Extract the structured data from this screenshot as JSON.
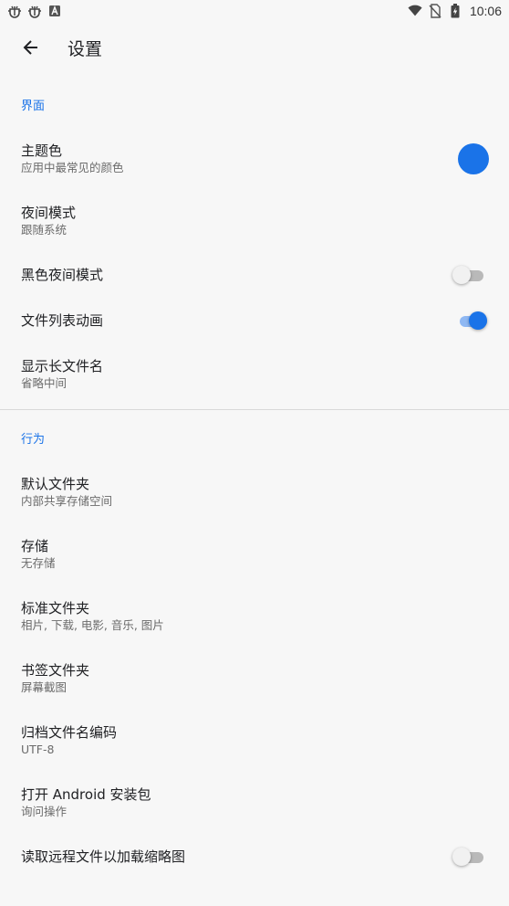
{
  "status_bar": {
    "time": "10:06",
    "left_icons": [
      "bug-icon",
      "bug-icon",
      "font-icon"
    ],
    "right_icons": [
      "wifi-icon",
      "no-sim-icon",
      "battery-charging-icon"
    ]
  },
  "app_bar": {
    "title": "设置",
    "back_icon": "arrow-back-icon"
  },
  "colors": {
    "accent": "#1a73e8",
    "theme_color": "#1a73e8"
  },
  "sections": {
    "interface": {
      "header": "界面",
      "theme_color": {
        "title": "主题色",
        "summary": "应用中最常见的颜色"
      },
      "night_mode": {
        "title": "夜间模式",
        "summary": "跟随系统"
      },
      "black_night_mode": {
        "title": "黑色夜间模式",
        "checked": false
      },
      "file_list_animation": {
        "title": "文件列表动画",
        "checked": true
      },
      "long_file_name": {
        "title": "显示长文件名",
        "summary": "省略中间"
      }
    },
    "behavior": {
      "header": "行为",
      "default_folder": {
        "title": "默认文件夹",
        "summary": "内部共享存储空间"
      },
      "storage": {
        "title": "存储",
        "summary": "无存储"
      },
      "standard_folders": {
        "title": "标准文件夹",
        "summary": "相片, 下载, 电影, 音乐, 图片"
      },
      "bookmark_folders": {
        "title": "书签文件夹",
        "summary": "屏幕截图"
      },
      "archive_encoding": {
        "title": "归档文件名编码",
        "summary": "UTF-8"
      },
      "open_apk": {
        "title": "打开 Android 安装包",
        "summary": "询问操作"
      },
      "remote_thumbnails": {
        "title": "读取远程文件以加载缩略图",
        "checked": false
      }
    }
  }
}
